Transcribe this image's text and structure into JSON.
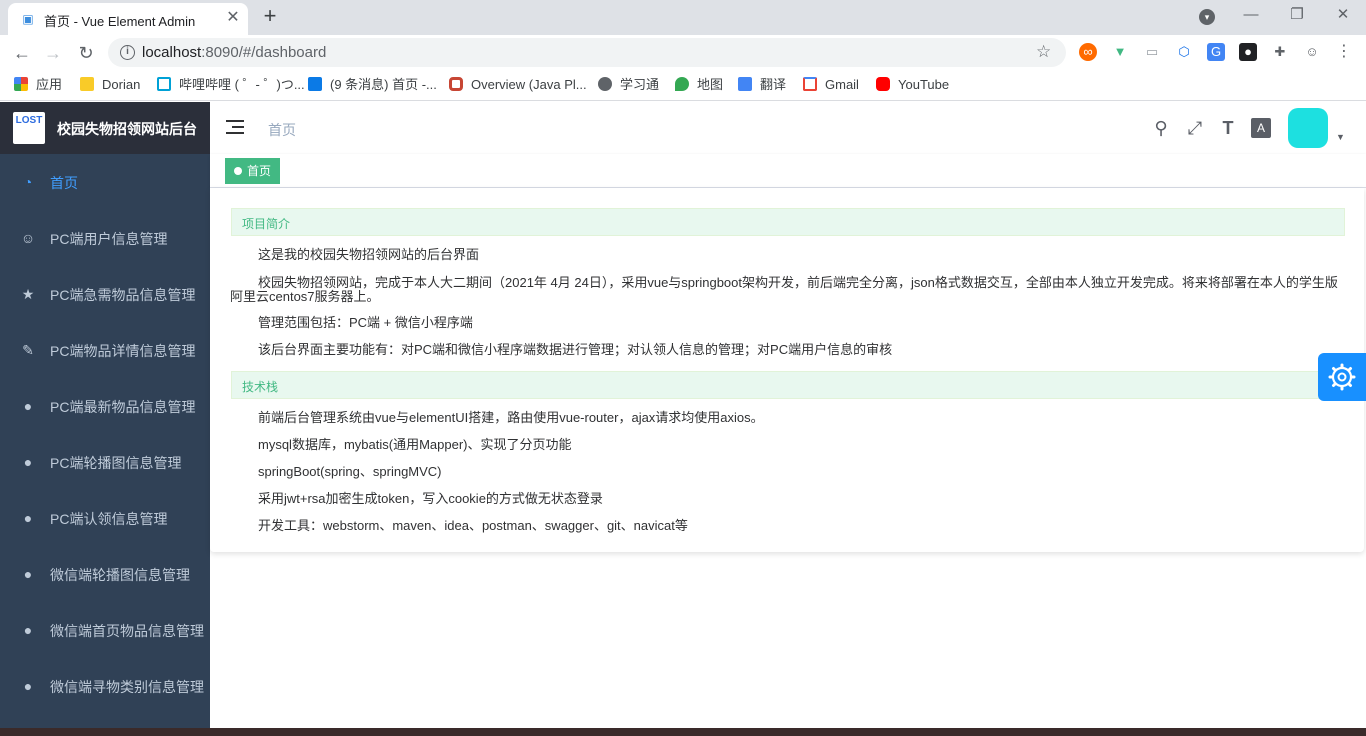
{
  "browser": {
    "tab_title": "首页 - Vue Element Admin",
    "tab_favicon": "lock-icon",
    "url_host": "localhost",
    "url_rest": ":8090/#/dashboard",
    "bookmarks": [
      {
        "label": "应用",
        "icon": "apps-grid-icon",
        "color": "#ea4335"
      },
      {
        "label": "Dorian",
        "icon": "folder-icon",
        "color": "#f9cb28"
      },
      {
        "label": "哔哩哔哩 ( ゜- ゜)つ...",
        "icon": "bilibili-icon",
        "color": "#00a1d6"
      },
      {
        "label": "(9 条消息) 首页 -...",
        "icon": "zhihu-icon",
        "color": "#0b7ae6"
      },
      {
        "label": "Overview (Java Pl...",
        "icon": "oracle-icon",
        "color": "#c74634"
      },
      {
        "label": "学习通",
        "icon": "globe-icon",
        "color": "#5f6368"
      },
      {
        "label": "地图",
        "icon": "map-pin-icon",
        "color": "#34a853"
      },
      {
        "label": "翻译",
        "icon": "translate-icon",
        "color": "#4285f4"
      },
      {
        "label": "Gmail",
        "icon": "gmail-icon",
        "color": "#ea4335"
      },
      {
        "label": "YouTube",
        "icon": "youtube-icon",
        "color": "#ff0000"
      }
    ]
  },
  "sidebar": {
    "title": "校园失物招领网站后台",
    "logo_text": "LOST",
    "items": [
      {
        "label": "首页",
        "icon": "dashboard-icon",
        "active": true
      },
      {
        "label": "PC端用户信息管理",
        "icon": "user-icon",
        "active": false
      },
      {
        "label": "PC端急需物品信息管理",
        "icon": "star-icon",
        "active": false
      },
      {
        "label": "PC端物品详情信息管理",
        "icon": "edit-icon",
        "active": false
      },
      {
        "label": "PC端最新物品信息管理",
        "icon": "globe-icon",
        "active": false
      },
      {
        "label": "PC端轮播图信息管理",
        "icon": "globe-icon",
        "active": false
      },
      {
        "label": "PC端认领信息管理",
        "icon": "globe-icon",
        "active": false
      },
      {
        "label": "微信端轮播图信息管理",
        "icon": "globe-icon",
        "active": false
      },
      {
        "label": "微信端首页物品信息管理",
        "icon": "globe-icon",
        "active": false
      },
      {
        "label": "微信端寻物类别信息管理",
        "icon": "globe-icon",
        "active": false
      }
    ]
  },
  "navbar": {
    "breadcrumb": "首页"
  },
  "tags": {
    "active": "首页"
  },
  "content": {
    "section1_title": "项目简介",
    "section1_paras": [
      "这是我的校园失物招领网站的后台界面",
      "校园失物招领网站，完成于本人大二期间（2021年 4月 24日），采用vue与springboot架构开发，前后端完全分离，json格式数据交互，全部由本人独立开发完成。将来将部署在本人的学生版阿里云centos7服务器上。",
      "管理范围包括：PC端 + 微信小程序端",
      "该后台界面主要功能有：对PC端和微信小程序端数据进行管理；对认领人信息的管理；对PC端用户信息的审核"
    ],
    "section2_title": "技术栈",
    "section2_paras": [
      "前端后台管理系统由vue与elementUI搭建，路由使用vue-router，ajax请求均使用axios。",
      "mysql数据库，mybatis(通用Mapper)、实现了分页功能",
      "springBoot(spring、springMVC)",
      "采用jwt+rsa加密生成token，写入cookie的方式做无状态登录",
      "开发工具：webstorm、maven、idea、postman、swagger、git、navicat等"
    ]
  },
  "colors": {
    "sidebar_bg": "#304156",
    "active": "#409eff",
    "tag": "#42b983",
    "settings": "#1890ff"
  }
}
